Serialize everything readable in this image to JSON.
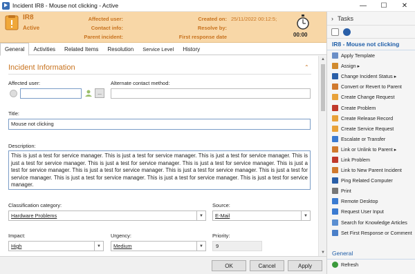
{
  "window": {
    "title": "Incident IR8 - Mouse not clicking - Active",
    "minimize": "—",
    "maximize": "☐",
    "close": "✕"
  },
  "header": {
    "id": "IR8",
    "status": "Active",
    "affected_user_label": "Affected user:",
    "affected_user_value": "",
    "contact_info_label": "Contact info:",
    "parent_incident_label": "Parent incident:",
    "created_on_label": "Created on:",
    "created_on_value": "25/11/2022 00:12:5;",
    "resolve_by_label": "Resolve by:",
    "first_response_label": "First response date",
    "timer": "00:00",
    "accent": "#c8731f"
  },
  "tabs": [
    "General",
    "Activities",
    "Related Items",
    "Resolution",
    "Service Level",
    "History"
  ],
  "form": {
    "section_title": "Incident Information",
    "affected_user_label": "Affected user:",
    "affected_user_value": "",
    "alt_contact_label": "Alternate contact method:",
    "alt_contact_value": "",
    "browse_label": "...",
    "title_label": "Title:",
    "title_value": "Mouse not clicking",
    "description_label": "Description:",
    "description_value": "This is just a test for service manager. This is just a test for service manager. This is just a test for service manager. This is just a test for service manager. This is just a test for service manager. This is just a test for service manager. This is just a test for service manager. This is just a test for service manager. This is just a test for service manager.  This is just a test for service manager.  This is just a test for service manager.  This is just a test for service manager. This is just a test for service manager.",
    "classification_label": "Classification category:",
    "classification_value": "Hardware Problems",
    "source_label": "Source:",
    "source_value": "E-Mail",
    "impact_label": "Impact:",
    "impact_value": "High",
    "urgency_label": "Urgency:",
    "urgency_value": "Medium",
    "priority_label": "Priority:",
    "priority_value": "9"
  },
  "footer": {
    "ok": "OK",
    "cancel": "Cancel",
    "apply": "Apply"
  },
  "tasks": {
    "header": "Tasks",
    "group_title": "IR8 - Mouse not clicking",
    "items": [
      {
        "label": "Apply Template",
        "icon": "template-icon",
        "color": "#6b8fc7"
      },
      {
        "label": "Assign ▸",
        "icon": "assign-icon",
        "color": "#d08a2e"
      },
      {
        "label": "Change Incident Status ▸",
        "icon": "status-icon",
        "color": "#2a5fa8"
      },
      {
        "label": "Convert or Revert to Parent",
        "icon": "convert-icon",
        "color": "#d07a2e"
      },
      {
        "label": "Create Change Request",
        "icon": "change-request-icon",
        "color": "#e8a23a"
      },
      {
        "label": "Create Problem",
        "icon": "problem-icon",
        "color": "#c0392b"
      },
      {
        "label": "Create Release Record",
        "icon": "release-icon",
        "color": "#e8a23a"
      },
      {
        "label": "Create Service Request",
        "icon": "service-request-icon",
        "color": "#e8a23a"
      },
      {
        "label": "Escalate or Transfer",
        "icon": "escalate-icon",
        "color": "#3b7bd1"
      },
      {
        "label": "Link or Unlink to Parent ▸",
        "icon": "link-icon",
        "color": "#d07a2e"
      },
      {
        "label": "Link Problem",
        "icon": "link-problem-icon",
        "color": "#c0392b"
      },
      {
        "label": "Link to New Parent Incident",
        "icon": "new-parent-icon",
        "color": "#d07a2e"
      },
      {
        "label": "Ping Related Computer",
        "icon": "ping-icon",
        "color": "#2a5fa8"
      },
      {
        "label": "Print",
        "icon": "print-icon",
        "color": "#777777"
      },
      {
        "label": "Remote Desktop",
        "icon": "remote-desktop-icon",
        "color": "#3b7bd1"
      },
      {
        "label": "Request User Input",
        "icon": "request-input-icon",
        "color": "#3b7bd1"
      },
      {
        "label": "Search for Knowledge Articles",
        "icon": "search-knowledge-icon",
        "color": "#5b8fd1"
      },
      {
        "label": "Set First Response or Comment",
        "icon": "first-response-icon",
        "color": "#4a7fc8"
      }
    ],
    "general_title": "General",
    "refresh_label": "Refresh"
  }
}
